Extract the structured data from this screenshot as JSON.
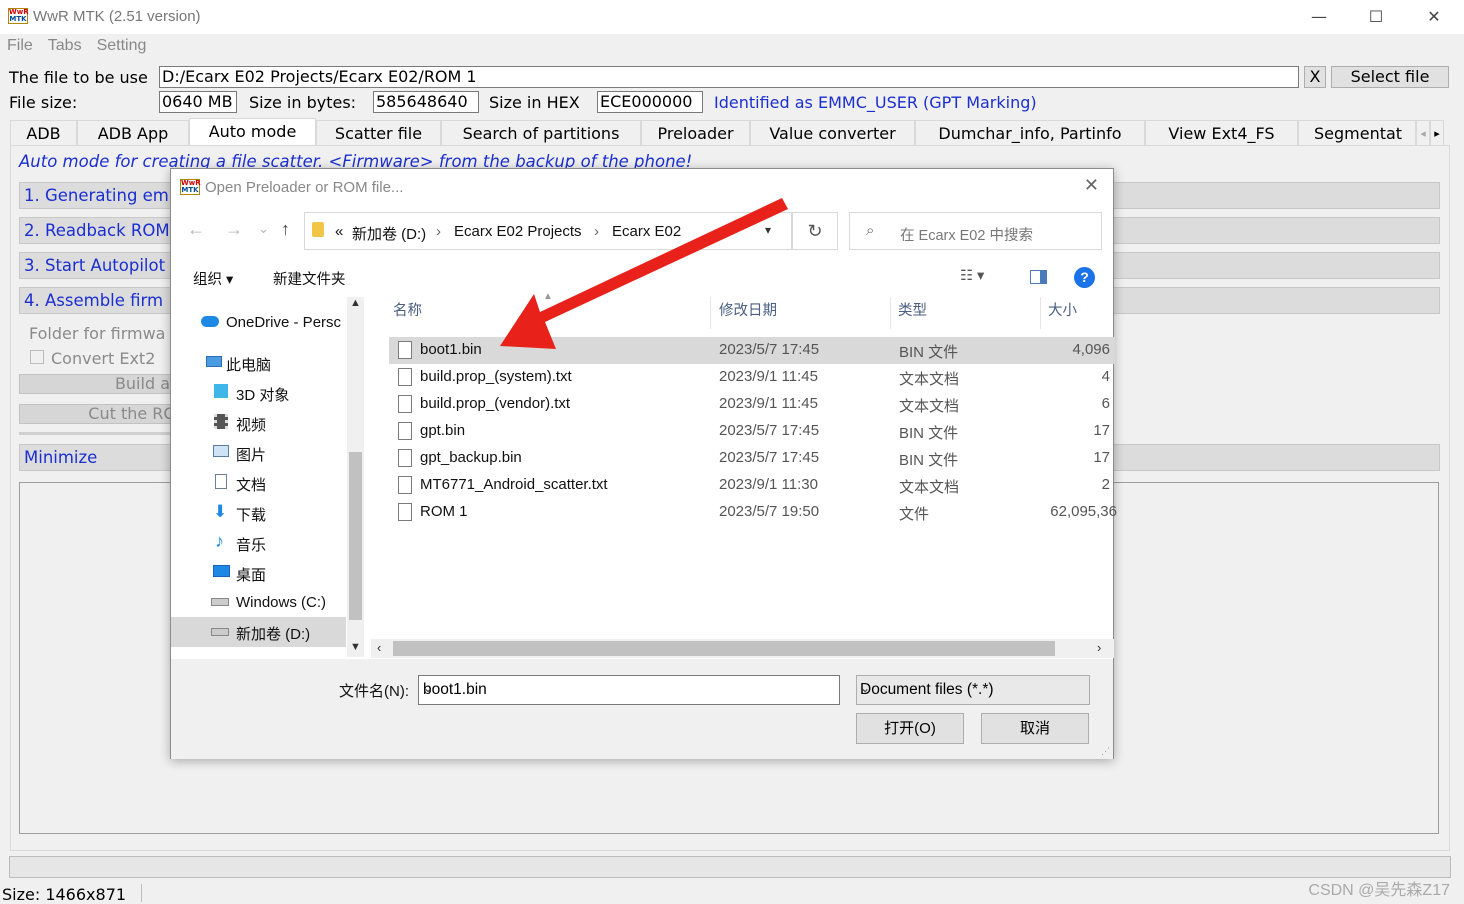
{
  "app": {
    "logo_top": "WwR",
    "logo_bottom": "MTK",
    "title": "WwR MTK (2.51 version)",
    "minimize_glyph": "—",
    "maximize_glyph": "☐",
    "close_glyph": "✕"
  },
  "menu": [
    "File",
    "Tabs",
    "Setting"
  ],
  "file_row": {
    "label": "The file to be use",
    "path": "D:/Ecarx E02 Projects/Ecarx E02/ROM 1",
    "clear_label": "X",
    "select_label": "Select file"
  },
  "size_row": {
    "label": "File size:",
    "mb_value": "0640 MB",
    "bytes_label": "Size in bytes:",
    "bytes_value": "585648640",
    "hex_label": "Size in HEX",
    "hex_value": "ECE000000",
    "identified": "Identified as EMMC_USER (GPT Marking)"
  },
  "tabs": [
    "ADB",
    "ADB App",
    "Auto mode",
    "Scatter file",
    "Search of partitions",
    "Preloader",
    "Value converter",
    "Dumchar_info, Partinfo",
    "View Ext4_FS",
    "Segmentat"
  ],
  "tab_scroll": {
    "left": "◂",
    "right": "▸"
  },
  "panel": {
    "description": "Auto mode for creating a file scatter. <Firmware> from the backup of the phone!",
    "steps": [
      "1. Generating em",
      "2. Readback ROM",
      "3. Start Autopilot",
      "4. Assemble firm"
    ],
    "folder_label": "Folder for firmwa",
    "convert_label": "Convert Ext2",
    "build_label": "Build a",
    "cut_label": "Cut the RO",
    "minimize_label": "Minimize"
  },
  "status": {
    "size_text": "Size: 1466x871"
  },
  "dialog": {
    "title": "Open Preloader or ROM file...",
    "close_glyph": "✕",
    "nav": {
      "back": "←",
      "forward": "→",
      "recent": "⌄",
      "up": "↑"
    },
    "breadcrumb": [
      "«",
      "新加卷 (D:)",
      "›",
      "Ecarx E02 Projects",
      "›",
      "Ecarx E02"
    ],
    "refresh_glyph": "↻",
    "search_placeholder": "在 Ecarx E02 中搜索",
    "organize_label": "组织 ▾",
    "new_folder_label": "新建文件夹",
    "help_glyph": "?",
    "sidebar": [
      {
        "label": "OneDrive - Persc",
        "icon": "cloud-icon"
      },
      {
        "label": "此电脑",
        "icon": "computer-icon"
      },
      {
        "label": "3D 对象",
        "icon": "cube-icon"
      },
      {
        "label": "视频",
        "icon": "video-icon"
      },
      {
        "label": "图片",
        "icon": "picture-icon"
      },
      {
        "label": "文档",
        "icon": "document-icon"
      },
      {
        "label": "下载",
        "icon": "download-icon"
      },
      {
        "label": "音乐",
        "icon": "music-icon"
      },
      {
        "label": "桌面",
        "icon": "desktop-icon"
      },
      {
        "label": "Windows (C:)",
        "icon": "drive-icon"
      },
      {
        "label": "新加卷 (D:)",
        "icon": "drive-icon"
      }
    ],
    "columns": {
      "name": "名称",
      "date": "修改日期",
      "type": "类型",
      "size": "大小"
    },
    "files": [
      {
        "name": "boot1.bin",
        "date": "2023/5/7 17:45",
        "type": "BIN 文件",
        "size": "4,096"
      },
      {
        "name": "build.prop_(system).txt",
        "date": "2023/9/1 11:45",
        "type": "文本文档",
        "size": "4"
      },
      {
        "name": "build.prop_(vendor).txt",
        "date": "2023/9/1 11:45",
        "type": "文本文档",
        "size": "6"
      },
      {
        "name": "gpt.bin",
        "date": "2023/5/7 17:45",
        "type": "BIN 文件",
        "size": "17"
      },
      {
        "name": "gpt_backup.bin",
        "date": "2023/5/7 17:45",
        "type": "BIN 文件",
        "size": "17"
      },
      {
        "name": "MT6771_Android_scatter.txt",
        "date": "2023/9/1 11:30",
        "type": "文本文档",
        "size": "2"
      },
      {
        "name": "ROM 1",
        "date": "2023/5/7 19:50",
        "type": "文件",
        "size": "62,095,36"
      }
    ],
    "filename_label": "文件名(N):",
    "filename_value": "boot1.bin",
    "filetype_value": "Document files (*.*)",
    "open_label": "打开(O)",
    "cancel_label": "取消"
  },
  "watermark": "CSDN @吴先森Z17",
  "colors": {
    "link_blue": "#1b2fd0",
    "arrow_red": "#e8221b",
    "help_blue": "#1a73e8"
  }
}
